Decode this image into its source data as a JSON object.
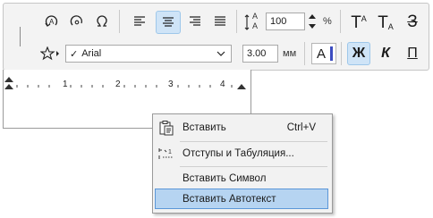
{
  "toolbar": {
    "size_value": "100",
    "size_unit": "%",
    "font_name": "Arial",
    "font_check": "✓",
    "height_value": "3.00",
    "height_unit": "мм",
    "pen_letter": "A",
    "bold_label": "Ж",
    "italic_label": "К",
    "underline_label": "П",
    "superscript_base": "T",
    "superscript_mark": "A",
    "subscript_base": "T",
    "subscript_mark": "A",
    "strike_label": "З",
    "line_spacing_top": "A",
    "line_spacing_bottom": "A",
    "colors": {
      "pen_accent": "#3b4cc0",
      "active_bg": "#cfe4f7",
      "highlight": "#b6d4f1"
    }
  },
  "ruler": {
    "numbers": [
      "1",
      "2",
      "3",
      "4"
    ]
  },
  "context_menu": {
    "items": [
      {
        "label": "Вставить",
        "shortcut": "Ctrl+V",
        "icon": "paste-icon"
      },
      {
        "label": "Отступы и Табуляция...",
        "shortcut": "",
        "icon": "tabs-indent-icon"
      },
      {
        "label": "Вставить Символ",
        "shortcut": "",
        "icon": ""
      },
      {
        "label": "Вставить Автотекст",
        "shortcut": "",
        "icon": "",
        "highlighted": true
      }
    ]
  }
}
